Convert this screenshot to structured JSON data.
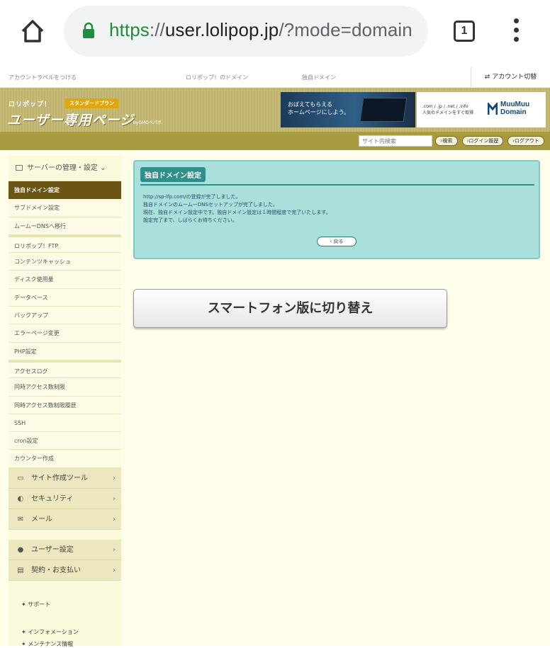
{
  "browser": {
    "url_scheme": "https",
    "url_sep": "://",
    "url_host": "user.lolipop.jp",
    "url_path": "/?mode=domain",
    "tab_count": "1"
  },
  "topbar": {
    "left_link": "アカウントラベルをつける",
    "mid_link1": "ロリポップ！のドメイン",
    "mid_link2": "独自ドメイン",
    "account_switch": "アカウント切替"
  },
  "header": {
    "brand": "ロリポップ！",
    "plan": "スタンダードプラン",
    "title": "ユーザー専用ページ",
    "operator": "byGMOペパボ",
    "banner1_text": "おぼえてもらえる\nホームページにしよう。",
    "banner2_text": ".com / .jp / .net / .info\n人気のドメインをすぐ取得",
    "banner2_logo_line1": "MuuMuu",
    "banner2_logo_line2": "Domain"
  },
  "search": {
    "placeholder": "サイト内検索",
    "search_button": "検索",
    "login_history": "ログイン履歴",
    "logout": "ログアウト"
  },
  "sidebar": {
    "section_title": "サーバーの管理・設定",
    "items": [
      "独自ドメイン設定",
      "サブドメイン設定",
      "ムームーDNSへ移行",
      "ロリポップ！FTP",
      "コンテンツキャッシュ",
      "ディスク使用量",
      "データベース",
      "バックアップ",
      "エラーページ変更",
      "PHP設定",
      "アクセスログ",
      "同時アクセス数制限",
      "同時アクセス数制限履歴",
      "SSH",
      "cron設定",
      "カウンター作成"
    ],
    "categories": [
      "サイト作成ツール",
      "セキュリティ",
      "メール",
      "ユーザー設定",
      "契約・お支払い"
    ],
    "links": [
      "サポート",
      "インフォメーション",
      "メンテナンス情報"
    ]
  },
  "panel": {
    "title": "独自ドメイン設定",
    "message_line1": "http://sp-lfp.com/の登録が完了しました。",
    "message_line2": "独自ドメインのムームーDNSセットアップが完了しました。",
    "message_line3": "現在、独自ドメイン設定中です。独自ドメイン設定は１時間程度で完了いたします。",
    "message_line4": "設定完了まで、しばらくお待ちください。",
    "back_button": "戻る"
  },
  "switch_button": "スマートフォン版に切り替え"
}
